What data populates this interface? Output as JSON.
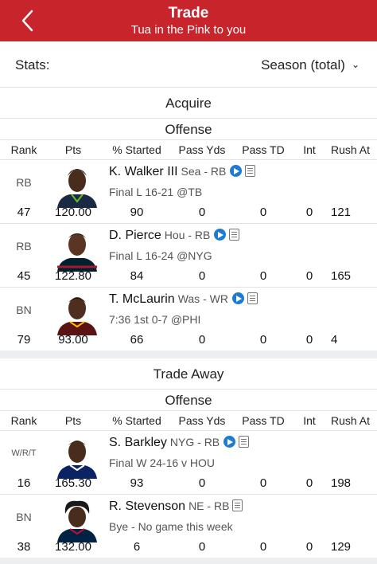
{
  "header": {
    "title": "Trade",
    "subtitle": "Tua in the Pink to you"
  },
  "stats_bar": {
    "label": "Stats:",
    "selected": "Season (total)"
  },
  "columns": [
    "Rank",
    "Pts",
    "% Started",
    "Pass Yds",
    "Pass TD",
    "Int",
    "Rush At"
  ],
  "acquire": {
    "title": "Acquire",
    "group": "Offense",
    "players": [
      {
        "slot": "RB",
        "name": "K. Walker III",
        "team": "Sea - RB",
        "info": "Final L 16-21 @TB",
        "has_video": true,
        "stats": {
          "rank": "47",
          "pts": "120.00",
          "started": "90",
          "pass_yds": "0",
          "pass_td": "0",
          "int": "0",
          "rush_att": "121"
        },
        "jersey_color": "#1b2a44",
        "trim_color": "#69be28"
      },
      {
        "slot": "RB",
        "name": "D. Pierce",
        "team": "Hou - RB",
        "info": "Final L 16-24 @NYG",
        "has_video": true,
        "stats": {
          "rank": "45",
          "pts": "122.80",
          "started": "84",
          "pass_yds": "0",
          "pass_td": "0",
          "int": "0",
          "rush_att": "165"
        },
        "jersey_color": "#03202f",
        "trim_color": "#a71930"
      },
      {
        "slot": "BN",
        "name": "T. McLaurin",
        "team": "Was - WR",
        "info": "7:36 1st 0-7 @PHI",
        "has_video": true,
        "stats": {
          "rank": "79",
          "pts": "93.00",
          "started": "66",
          "pass_yds": "0",
          "pass_td": "0",
          "int": "0",
          "rush_att": "4"
        },
        "jersey_color": "#5a1414",
        "trim_color": "#ffb612"
      }
    ]
  },
  "trade_away": {
    "title": "Trade Away",
    "group": "Offense",
    "players": [
      {
        "slot": "W/R/T",
        "name": "S. Barkley",
        "team": "NYG - RB",
        "info": "Final W 24-16 v HOU",
        "has_video": true,
        "stats": {
          "rank": "16",
          "pts": "165.30",
          "started": "93",
          "pass_yds": "0",
          "pass_td": "0",
          "int": "0",
          "rush_att": "198"
        },
        "jersey_color": "#0b2265",
        "trim_color": "#ffffff"
      },
      {
        "slot": "BN",
        "name": "R. Stevenson",
        "team": "NE - RB",
        "info": "Bye - No game this week",
        "has_video": false,
        "stats": {
          "rank": "38",
          "pts": "132.00",
          "started": "6",
          "pass_yds": "0",
          "pass_td": "0",
          "int": "0",
          "rush_att": "129"
        },
        "jersey_color": "#002244",
        "trim_color": "#c60c30"
      }
    ]
  },
  "colors": {
    "header_bg": "#c8242b",
    "video_icon": "#1e7bd2",
    "separator": "#eceef0"
  }
}
